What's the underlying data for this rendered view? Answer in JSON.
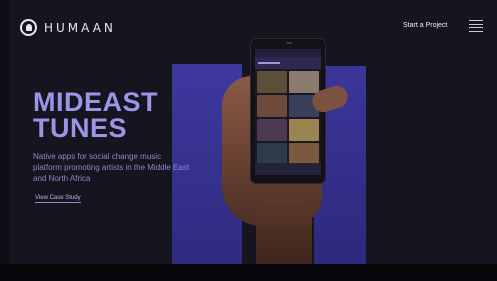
{
  "header": {
    "brand": "HUMAAN",
    "start_project_label": "Start a Project",
    "menu_icon": "hamburger-menu-icon"
  },
  "hero": {
    "headline_line1": "MIDEAST",
    "headline_line2": "TUNES",
    "description": "Native apps for social change music platform promoting artists in the Middle East and North Africa",
    "cta_label": "View Case Study"
  },
  "colors": {
    "background": "#16141f",
    "accent_purple": "#3a3598",
    "headline": "#9a95e6"
  },
  "phone": {
    "tiles": [
      "#5b4f3a",
      "#8a7a6c",
      "#6e4a3c",
      "#3a3f5c",
      "#4c3a52",
      "#9a8450",
      "#2e3a48",
      "#7a5a3c"
    ]
  }
}
